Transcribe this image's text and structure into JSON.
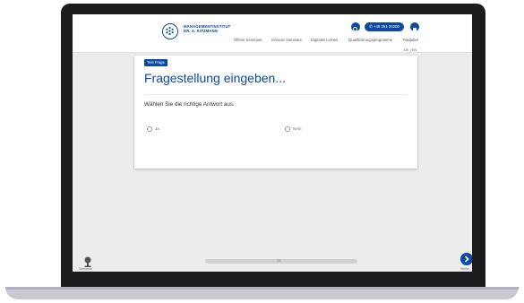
{
  "header": {
    "logo_line1": "MANAGEMENTINSTITUT",
    "logo_line2": "DR. A. KITZMANN",
    "phone": "+49 251 20200",
    "nav": [
      "Offene Seminare",
      "Inhouse Seminare",
      "Digitales Lernen",
      "Qualifizierungsprogramme",
      "Ratgeber"
    ],
    "lang": "DE | EN"
  },
  "question": {
    "badge": "Test Frage",
    "title": "Fragestellung eingeben...",
    "instruction": "Wählen Sie die richtige Antwort aus.",
    "options": [
      "Ja",
      "Nein"
    ]
  },
  "footer": {
    "home_label": "Startseite",
    "progress_text": "0/1",
    "next_label": "Weiter"
  },
  "colors": {
    "accent": "#0b4aa0"
  }
}
